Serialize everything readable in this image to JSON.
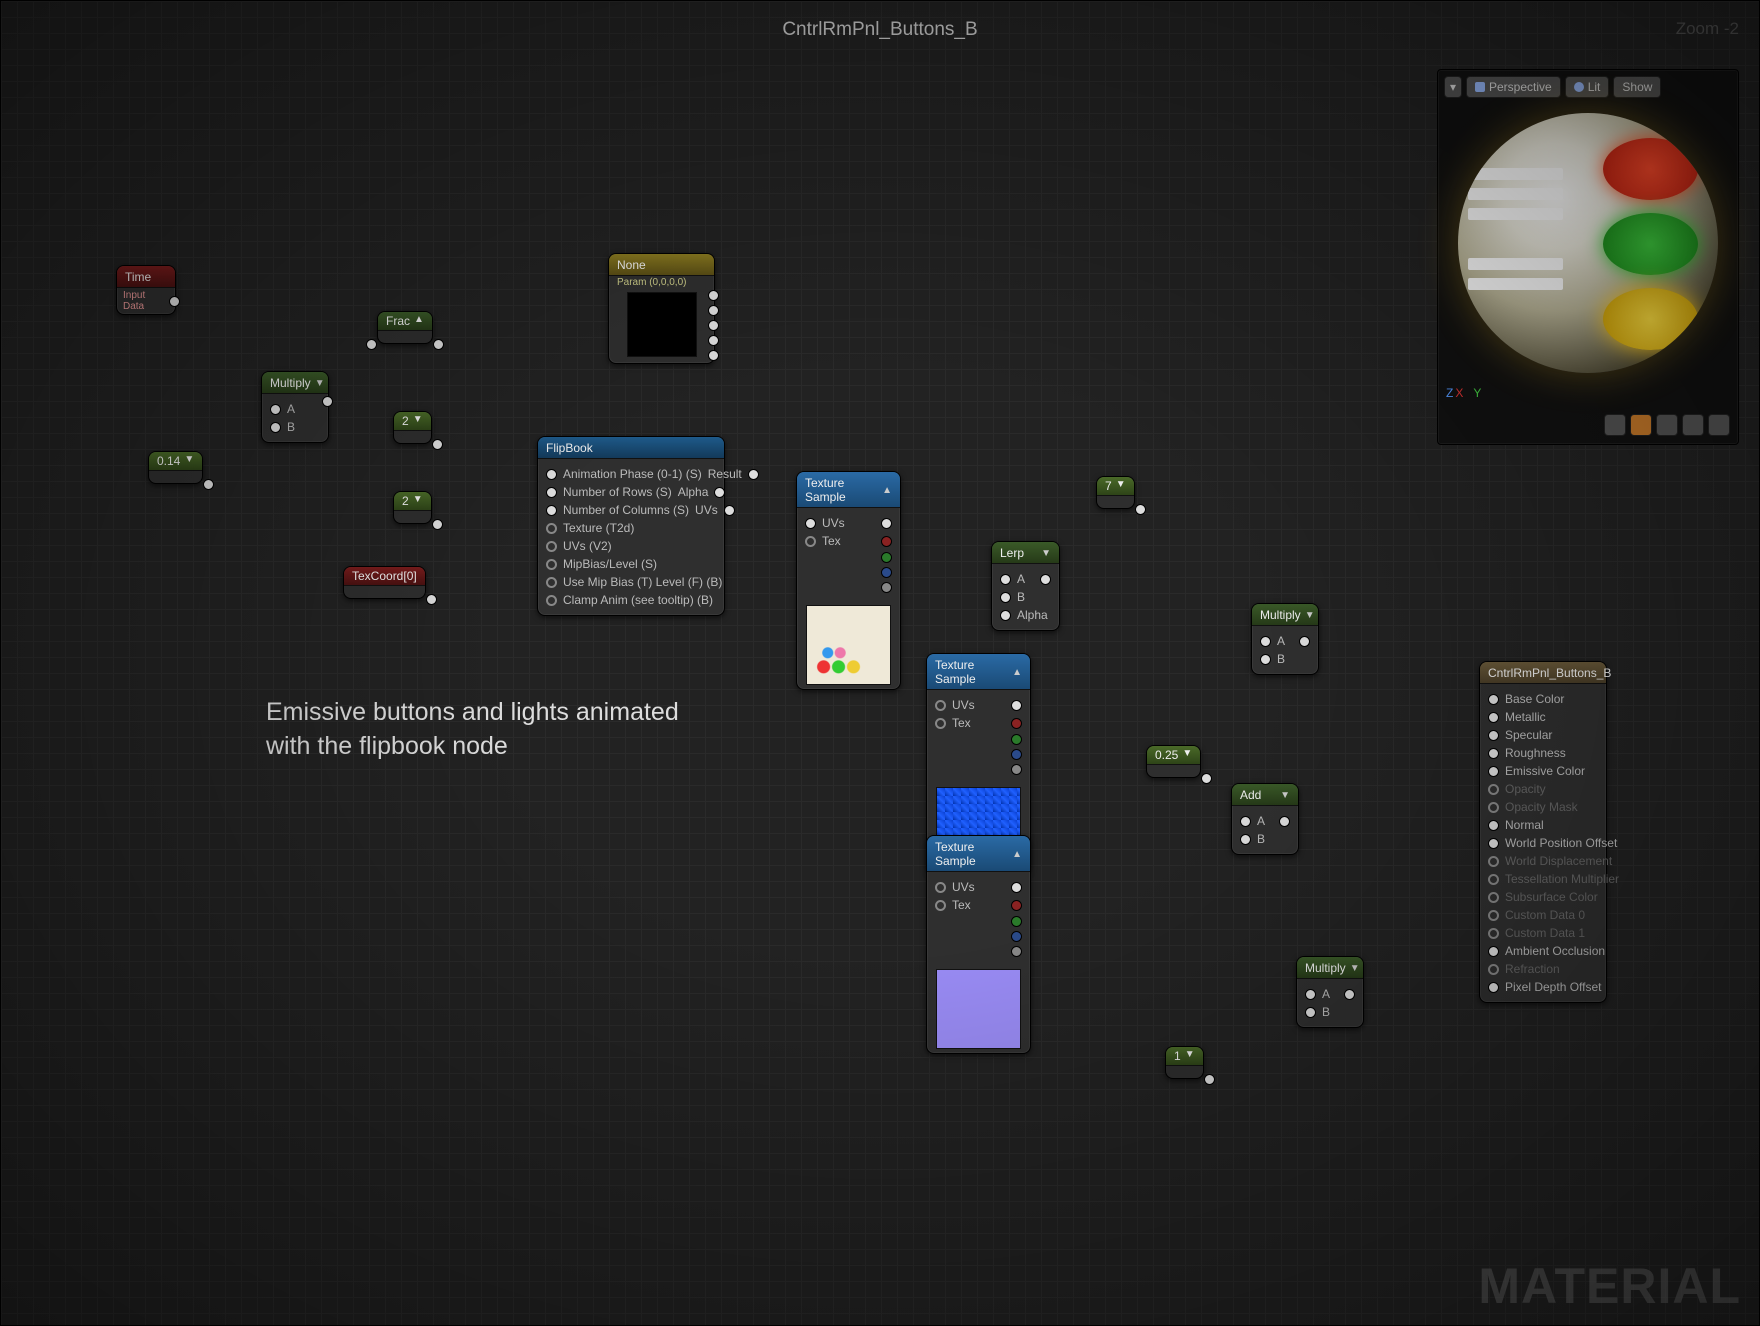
{
  "title": "CntrlRmPnl_Buttons_B",
  "zoom": "Zoom  -2",
  "watermark": "MATERIAL",
  "annotation": "Emissive buttons and lights animated\nwith the flipbook node",
  "preview": {
    "buttons": {
      "menu": "▾",
      "persp": "Perspective",
      "lit": "Lit",
      "show": "Show"
    }
  },
  "nodes": {
    "time": {
      "title": "Time",
      "sub": "Input Data"
    },
    "frac": {
      "title": "Frac"
    },
    "multiply1": {
      "title": "Multiply",
      "a": "A",
      "b": "B"
    },
    "texcoord": {
      "title": "TexCoord[0]"
    },
    "c014": {
      "title": "0.14"
    },
    "c2a": {
      "title": "2"
    },
    "c2b": {
      "title": "2"
    },
    "c7": {
      "title": "7"
    },
    "c025": {
      "title": "0.25"
    },
    "c1": {
      "title": "1"
    },
    "param": {
      "title": "None",
      "sub": "Param (0,0,0,0)"
    },
    "flipbook": {
      "title": "FlipBook",
      "in": [
        "Animation Phase (0-1) (S)",
        "Number of Rows (S)",
        "Number of Columns (S)",
        "Texture (T2d)",
        "UVs (V2)",
        "MipBias/Level (S)",
        "Use Mip Bias (T) Level (F) (B)",
        "Clamp Anim (see tooltip) (B)"
      ],
      "out": [
        "Result",
        "Alpha",
        "UVs"
      ]
    },
    "texsamp1": {
      "title": "Texture Sample",
      "uvs": "UVs",
      "tex": "Tex"
    },
    "texsamp2": {
      "title": "Texture Sample",
      "uvs": "UVs",
      "tex": "Tex"
    },
    "texsamp3": {
      "title": "Texture Sample",
      "uvs": "UVs",
      "tex": "Tex"
    },
    "lerp": {
      "title": "Lerp",
      "a": "A",
      "b": "B",
      "alpha": "Alpha"
    },
    "multiply2": {
      "title": "Multiply",
      "a": "A",
      "b": "B"
    },
    "multiply3": {
      "title": "Multiply",
      "a": "A",
      "b": "B"
    },
    "add": {
      "title": "Add",
      "a": "A",
      "b": "B"
    },
    "material": {
      "title": "CntrlRmPnl_Buttons_B",
      "pins": [
        {
          "l": "Base Color",
          "on": true
        },
        {
          "l": "Metallic",
          "on": true
        },
        {
          "l": "Specular",
          "on": true
        },
        {
          "l": "Roughness",
          "on": true
        },
        {
          "l": "Emissive Color",
          "on": true
        },
        {
          "l": "Opacity",
          "on": false
        },
        {
          "l": "Opacity Mask",
          "on": false
        },
        {
          "l": "Normal",
          "on": true
        },
        {
          "l": "World Position Offset",
          "on": true
        },
        {
          "l": "World Displacement",
          "on": false
        },
        {
          "l": "Tessellation Multiplier",
          "on": false
        },
        {
          "l": "Subsurface Color",
          "on": false
        },
        {
          "l": "Custom Data 0",
          "on": false
        },
        {
          "l": "Custom Data 1",
          "on": false
        },
        {
          "l": "Ambient Occlusion",
          "on": true
        },
        {
          "l": "Refraction",
          "on": false
        },
        {
          "l": "Pixel Depth Offset",
          "on": true
        }
      ]
    }
  }
}
